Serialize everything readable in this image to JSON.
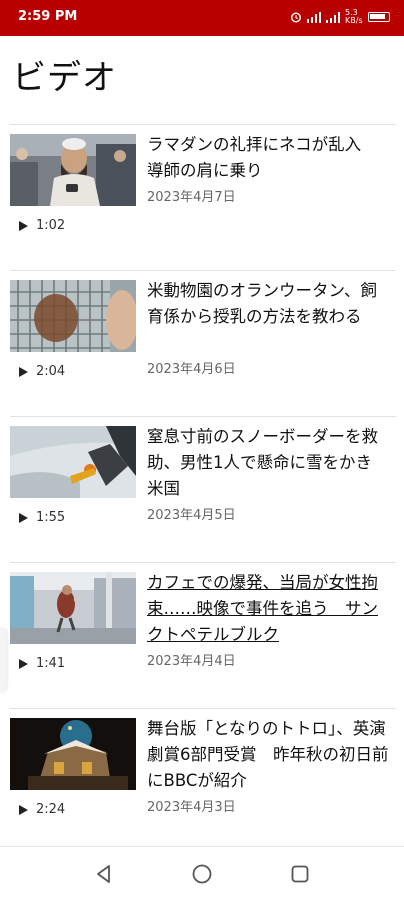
{
  "status_bar": {
    "time": "2:59 PM",
    "network_label": "5.3 KB/s",
    "colors": {
      "background": "#b80000"
    }
  },
  "page": {
    "title": "ビデオ"
  },
  "videos": [
    {
      "headline": "ラマダンの礼拝にネコが乱入　導師の肩に乗り",
      "date": "2023年4月7日",
      "duration": "1:02"
    },
    {
      "headline": "米動物園のオランウータン、飼育係から授乳の方法を教わる",
      "date": "2023年4月6日",
      "duration": "2:04"
    },
    {
      "headline": "窒息寸前のスノーボーダーを救助、男性1人で懸命に雪をかき　米国",
      "date": "2023年4月5日",
      "duration": "1:55"
    },
    {
      "headline": "カフェでの爆発、当局が女性拘束……映像で事件を追う　サンクトペテルブルク",
      "date": "2023年4月4日",
      "duration": "1:41"
    },
    {
      "headline": "舞台版「となりのトトロ」、英演劇賞6部門受賞　昨年秋の初日前にBBCが紹介",
      "date": "2023年4月3日",
      "duration": "2:24"
    }
  ],
  "nav": {
    "icons": [
      "back-icon",
      "home-icon",
      "recents-icon"
    ]
  }
}
